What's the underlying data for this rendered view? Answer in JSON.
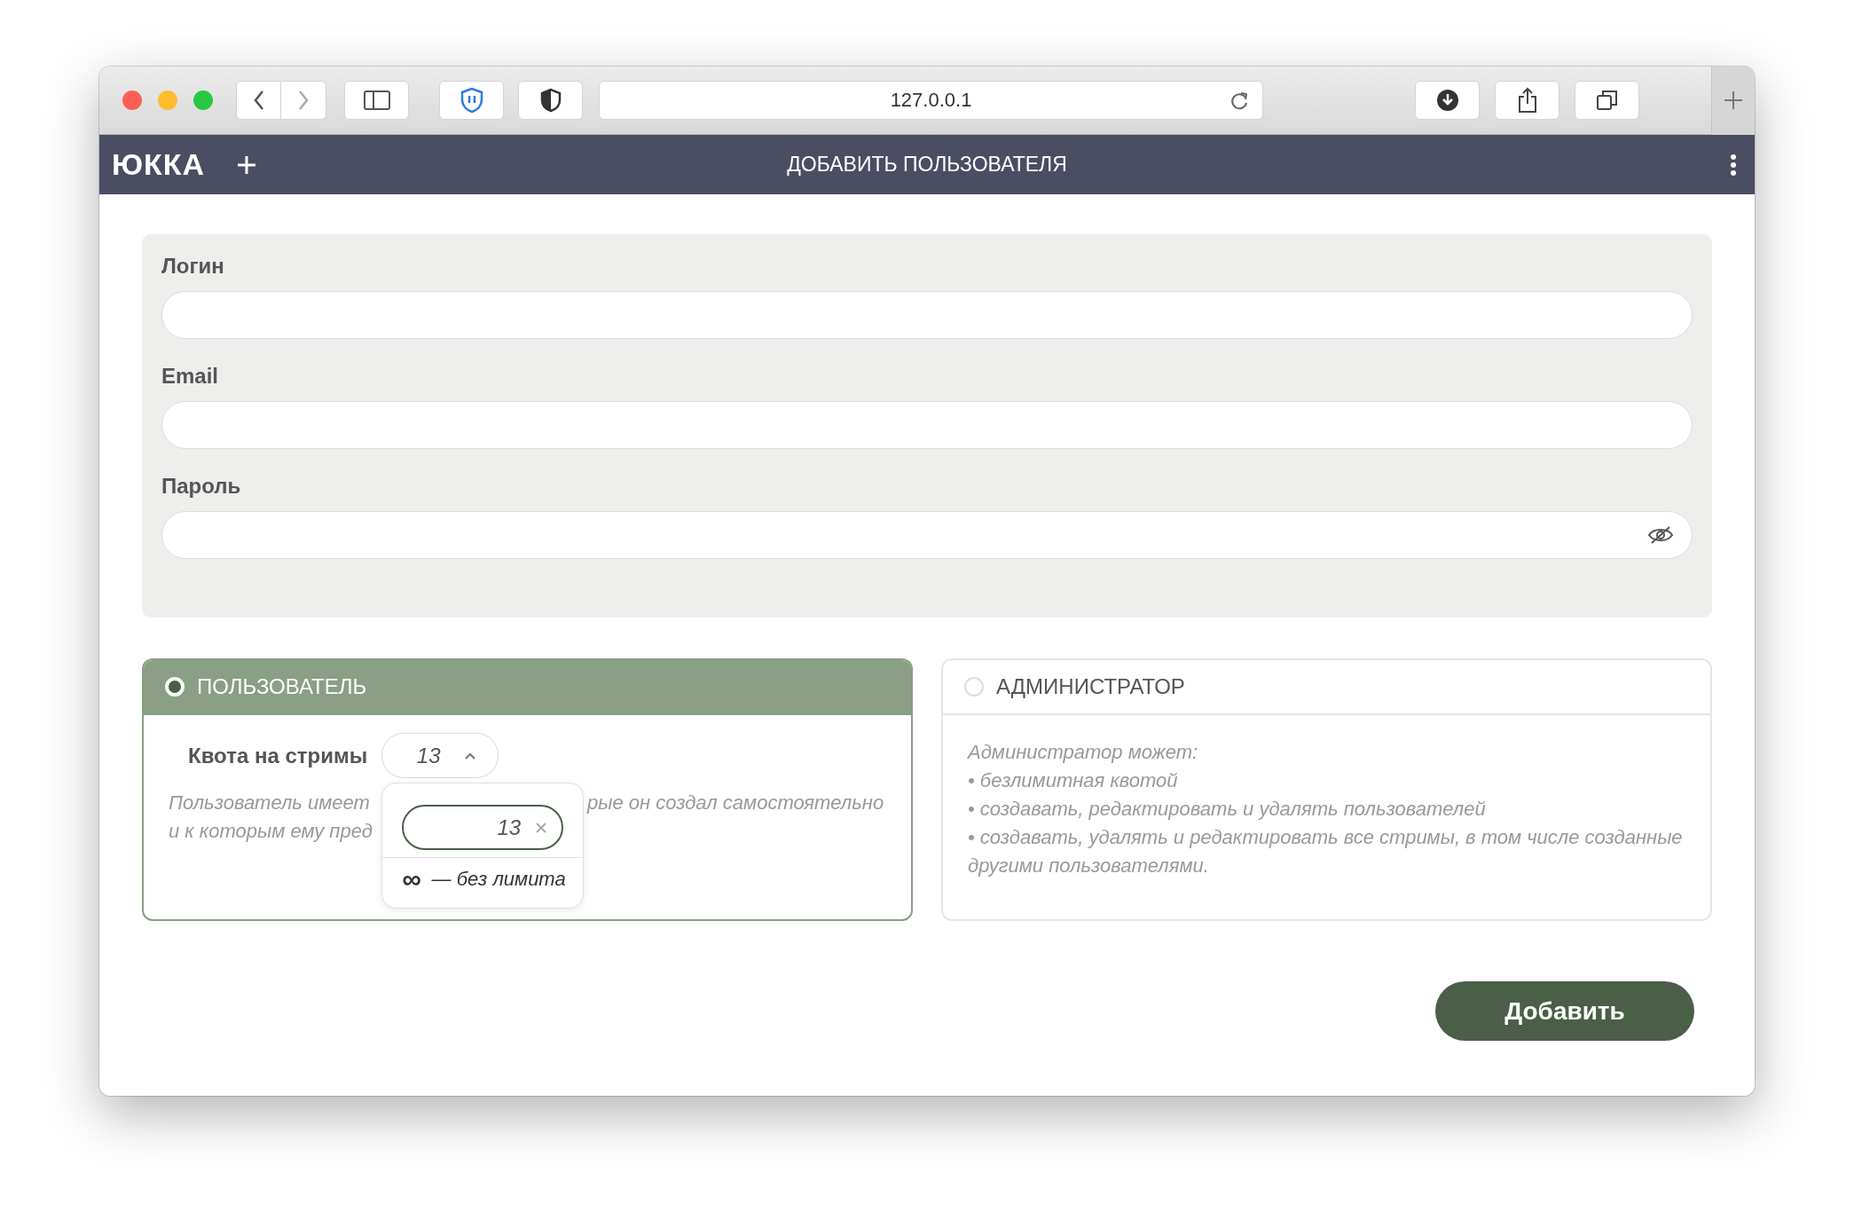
{
  "browser": {
    "url": "127.0.0.1"
  },
  "app_bar": {
    "logo": "ЮККА",
    "title": "ДОБАВИТЬ ПОЛЬЗОВАТЕЛЯ"
  },
  "form": {
    "fields": [
      {
        "label": "Логин",
        "kind": "text"
      },
      {
        "label": "Email",
        "kind": "text"
      },
      {
        "label": "Пароль",
        "kind": "password"
      }
    ]
  },
  "roles": [
    {
      "kind": "quota",
      "title": "ПОЛЬЗОВАТЕЛЬ",
      "selected": true,
      "quota": {
        "label": "Квота на стримы",
        "value": "13",
        "expanded": true,
        "input_value": "13",
        "symbol": "∞",
        "option": "— без лимита"
      },
      "description_lines": [
        [
          "Пользователь имеет",
          "рые он создал самостоятельно"
        ],
        [
          "и к которым ему пред"
        ]
      ]
    },
    {
      "kind": "list",
      "title": "АДМИНИСТРАТОР",
      "selected": false,
      "intro": "Администратор может:",
      "items": [
        "• безлимитная квотой",
        "• создавать, редактировать и удалять пользователей",
        "• создавать, удалять и редактировать все стримы, в том числе созданные другими пользователями."
      ]
    }
  ],
  "submit": "Добавить"
}
